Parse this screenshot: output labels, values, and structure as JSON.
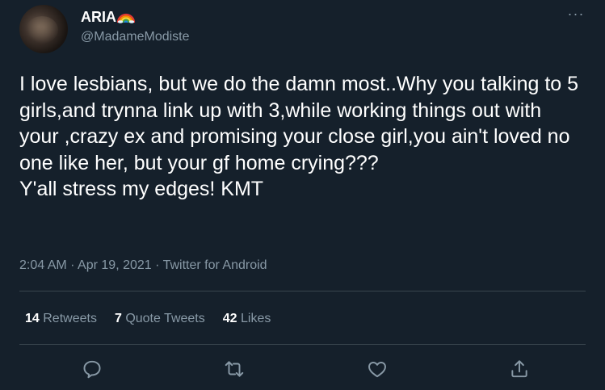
{
  "author": {
    "display_name": "ARIA",
    "handle": "@MadameModiste",
    "name_emoji": "rainbow-icon"
  },
  "menu": {
    "more_label": "···"
  },
  "tweet": {
    "text": "I love lesbians, but we do the damn most..Why you talking to 5 girls,and trynna link up with 3,while working things out with your ,crazy ex and promising your close girl,you ain't loved no one like her, but your gf home crying???\nY'all stress my edges! KMT"
  },
  "meta": {
    "time": "2:04 AM",
    "sep1": " · ",
    "date": "Apr 19, 2021",
    "sep2": " · ",
    "source": "Twitter for Android"
  },
  "stats": {
    "retweets_count": "14",
    "retweets_label": "Retweets",
    "quotes_count": "7",
    "quotes_label": "Quote Tweets",
    "likes_count": "42",
    "likes_label": "Likes"
  },
  "actions": {
    "reply": "reply-icon",
    "retweet": "retweet-icon",
    "like": "like-icon",
    "share": "share-icon"
  },
  "colors": {
    "background": "#15202b",
    "text_primary": "#ffffff",
    "text_secondary": "#8899a6",
    "divider": "#38444d"
  }
}
